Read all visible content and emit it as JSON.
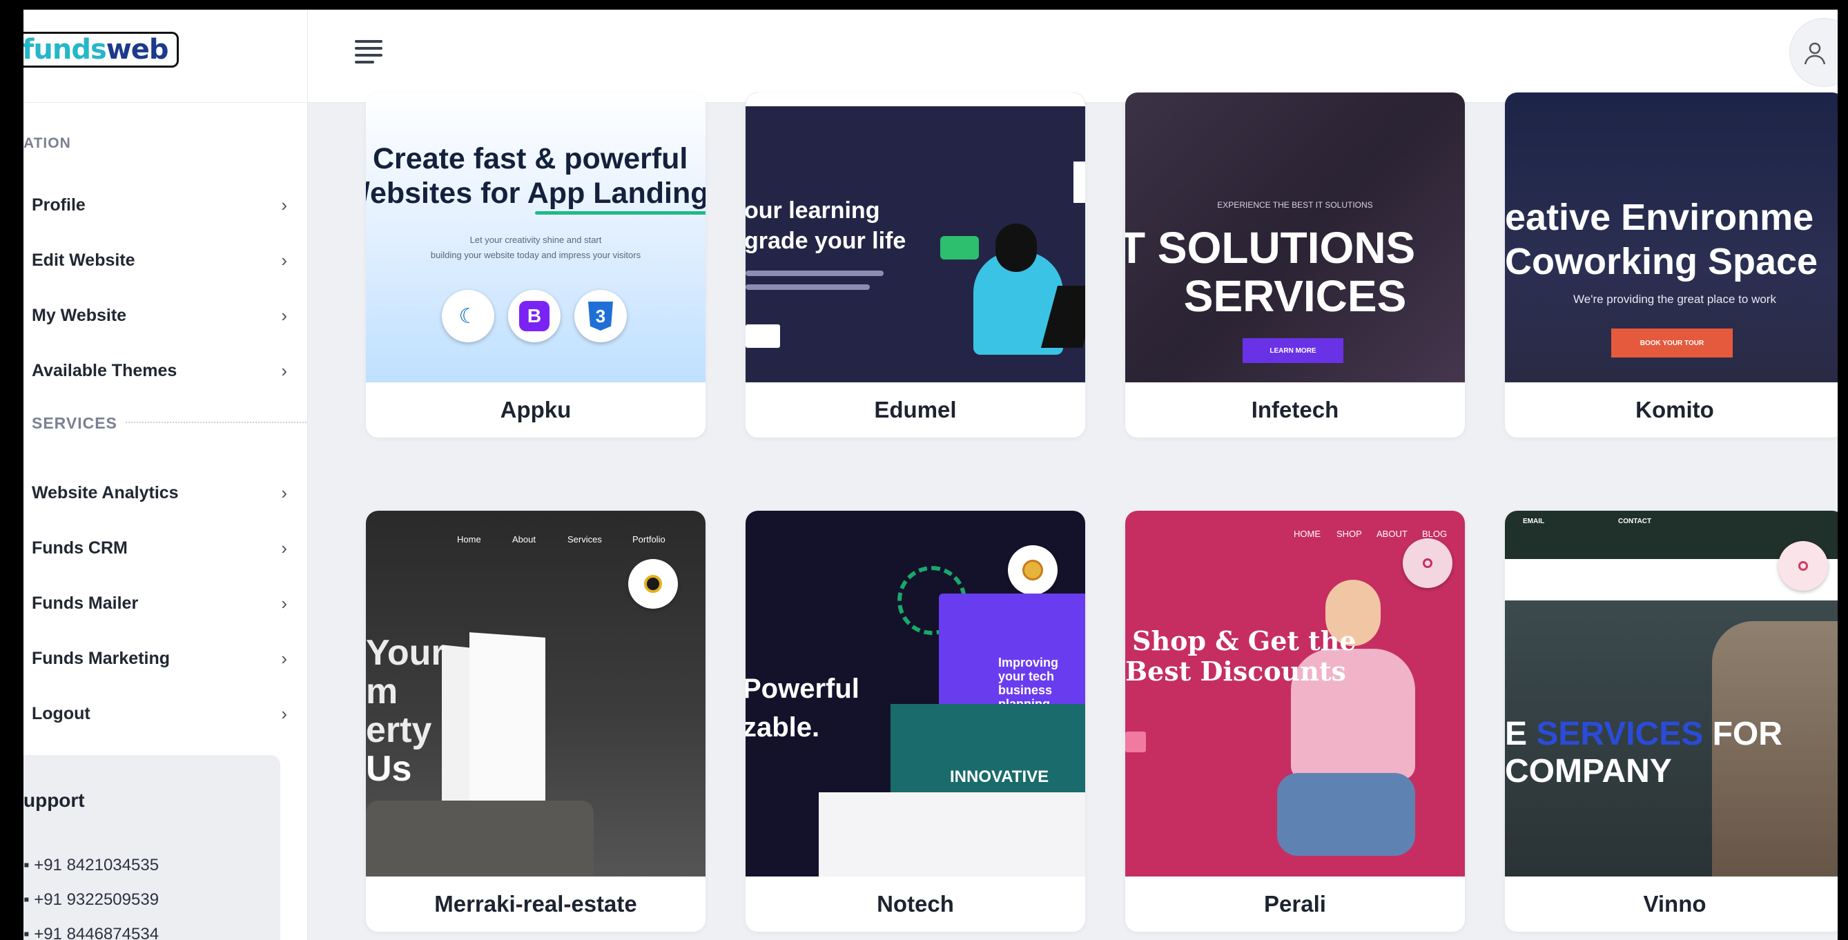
{
  "brand": {
    "logo_part1": "funds",
    "logo_part2": "web"
  },
  "sidebar": {
    "section1_label": "ATION",
    "items": [
      {
        "label": "Profile"
      },
      {
        "label": "Edit Website"
      },
      {
        "label": "My Website"
      },
      {
        "label": "Available Themes"
      }
    ],
    "section2_label": "SERVICES",
    "services": [
      {
        "label": "Website Analytics"
      },
      {
        "label": "Funds CRM"
      },
      {
        "label": "Funds Mailer"
      },
      {
        "label": "Funds Marketing"
      },
      {
        "label": "Logout"
      }
    ],
    "chevron": "›",
    "support": {
      "title": "upport",
      "phones": [
        "+91 8421034535",
        "+91 9322509539",
        "+91 8446874534"
      ]
    }
  },
  "topbar": {
    "menu_icon": "hamburger-menu-icon",
    "avatar_icon": "user-avatar-icon"
  },
  "themes": [
    {
      "name": "Appku",
      "preview": {
        "headline1": "Create fast & powerful",
        "headline2": "/ebsites for App Landing",
        "sub1": "Let your creativity shine and start",
        "sub2": "building your website today and impress your visitors",
        "icon1": "jquery-icon",
        "icon2": "B",
        "icon3": "css3-icon"
      }
    },
    {
      "name": "Edumel",
      "preview": {
        "headline1": "our learning",
        "headline2": "grade your life"
      }
    },
    {
      "name": "Infetech",
      "preview": {
        "small": "EXPERIENCE THE BEST IT SOLUTIONS",
        "headline1": "T SOLUTIONS",
        "headline2": "SERVICES",
        "button": "LEARN MORE"
      }
    },
    {
      "name": "Komito",
      "preview": {
        "headline1": "eative Environme",
        "headline2": "Coworking Space",
        "sub": "We're providing the great place to work",
        "button": "BOOK YOUR TOUR"
      }
    },
    {
      "name": "Merraki-real-estate",
      "preview": {
        "nav": [
          "Home",
          "About",
          "Services",
          "Portfolio"
        ],
        "headline": [
          "Your",
          "m",
          "erty",
          "Us"
        ]
      }
    },
    {
      "name": "Notech",
      "preview": {
        "headline1": "Powerful",
        "headline2": "zable.",
        "box": "Improving your tech business planning",
        "banner": "INNOVATIVE"
      }
    },
    {
      "name": "Perali",
      "preview": {
        "nav": [
          "HOME",
          "SHOP",
          "ABOUT",
          "BLOG"
        ],
        "headline1": "Shop & Get the",
        "headline2": "Best Discounts"
      }
    },
    {
      "name": "Vinno",
      "preview": {
        "top1": "EMAIL",
        "top2": "CONTACT",
        "headline1a": "E",
        "headline1b": "SERVICES",
        "headline1c": "FOR",
        "headline2": "COMPANY"
      }
    }
  ],
  "colors": {
    "accent_teal": "#27b6c9",
    "brand_blue": "#1b3a8c"
  }
}
